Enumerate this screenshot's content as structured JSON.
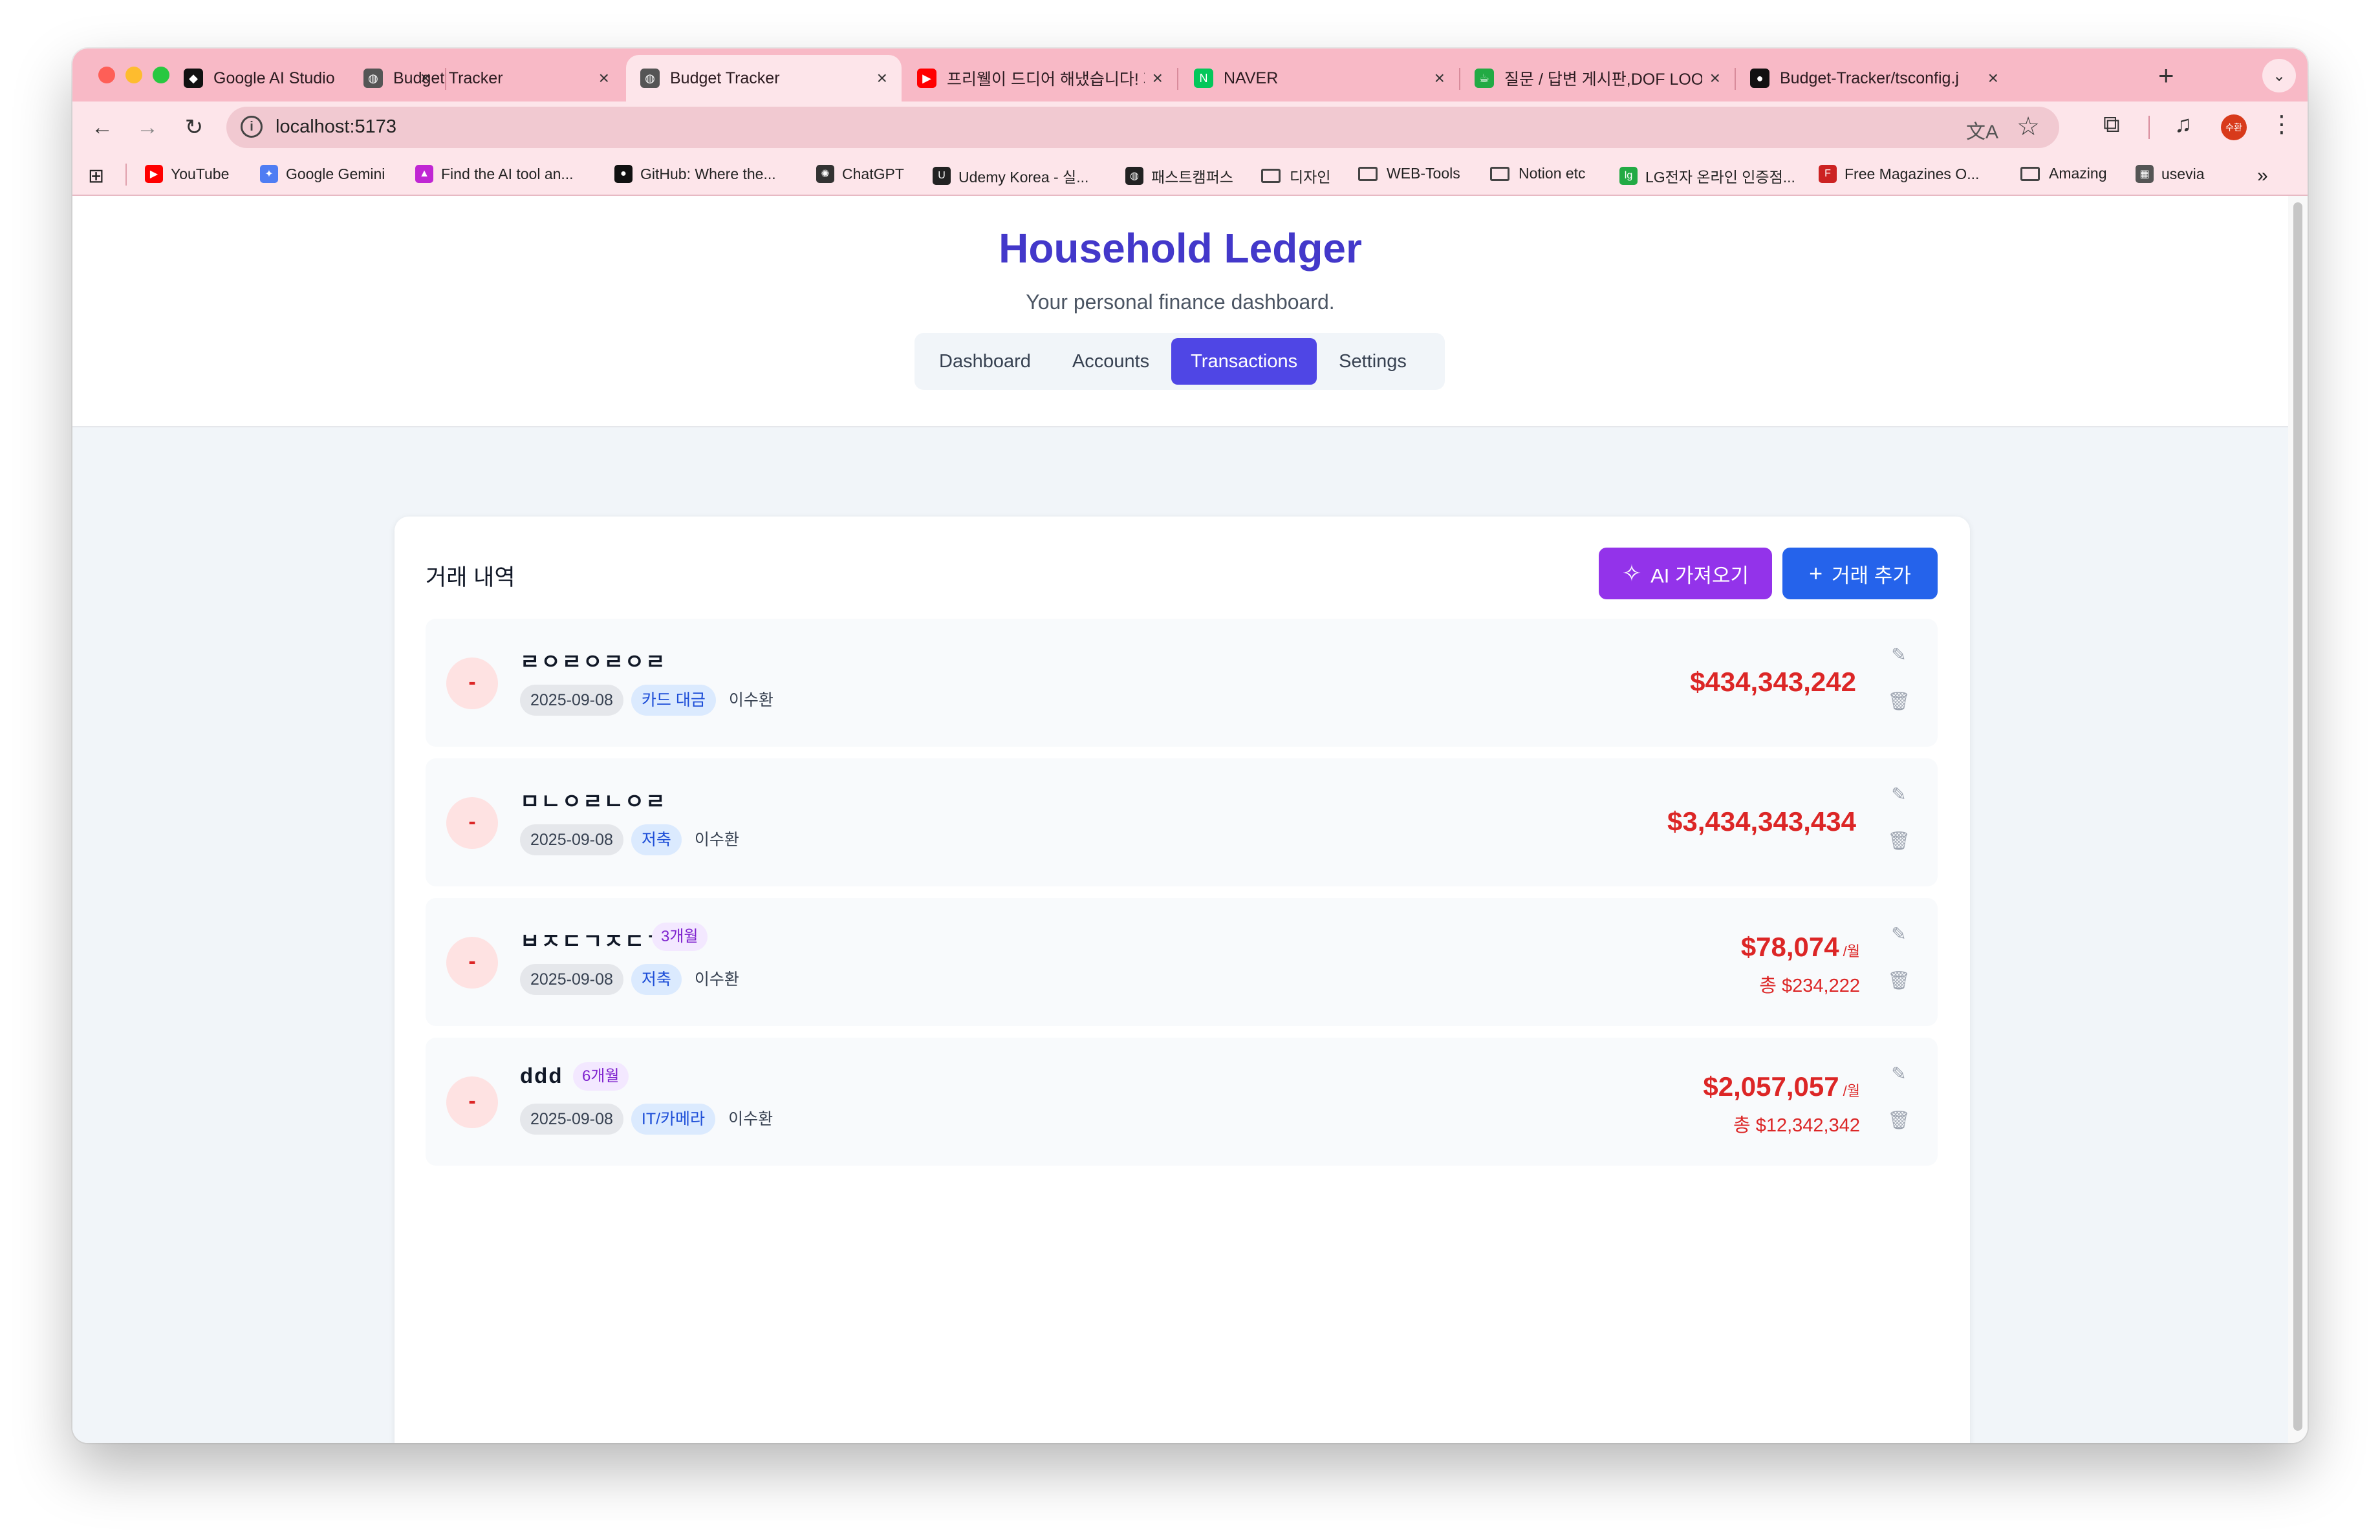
{
  "browser": {
    "tabs": [
      {
        "title": "Google AI Studio",
        "favicon": "ai-studio-icon",
        "color": "#111111",
        "active": false
      },
      {
        "title": "Budget Tracker",
        "favicon": "globe-icon",
        "color": "#555555",
        "active": false
      },
      {
        "title": "Budget Tracker",
        "favicon": "globe-icon",
        "color": "#555555",
        "active": true
      },
      {
        "title": "프리웰이 드디어 해냈습니다! 자",
        "favicon": "youtube-icon",
        "color": "#ff0000",
        "active": false
      },
      {
        "title": "NAVER",
        "favicon": "naver-icon",
        "color": "#03c75a",
        "active": false
      },
      {
        "title": "질문 / 답변 게시판,DOF LOOK",
        "favicon": "cup-icon",
        "color": "#22aa44",
        "active": false
      },
      {
        "title": "Budget-Tracker/tsconfig.j",
        "favicon": "github-icon",
        "color": "#111111",
        "active": false
      }
    ],
    "address": "localhost:5173",
    "bookmarks": [
      {
        "label": "YouTube",
        "icon": "youtube-icon",
        "color": "#ff0000",
        "folder": false
      },
      {
        "label": "Google Gemini",
        "icon": "gemini-icon",
        "color": "#4f7df3",
        "folder": false
      },
      {
        "label": "Find the AI tool an...",
        "icon": "ai-tool-icon",
        "color": "#c026d3",
        "folder": false
      },
      {
        "label": "GitHub: Where the...",
        "icon": "github-icon",
        "color": "#111111",
        "folder": false
      },
      {
        "label": "ChatGPT",
        "icon": "chatgpt-icon",
        "color": "#333333",
        "folder": false
      },
      {
        "label": "Udemy Korea - 실...",
        "icon": "udemy-icon",
        "color": "#222222",
        "folder": false
      },
      {
        "label": "패스트캠퍼스",
        "icon": "globe-icon",
        "color": "#222222",
        "folder": false
      },
      {
        "label": "디자인",
        "icon": "folder-icon",
        "color": "#444444",
        "folder": true
      },
      {
        "label": "WEB-Tools",
        "icon": "folder-icon",
        "color": "#444444",
        "folder": true
      },
      {
        "label": "Notion etc",
        "icon": "folder-icon",
        "color": "#444444",
        "folder": true
      },
      {
        "label": "LG전자 온라인 인증점...",
        "icon": "lg-icon",
        "color": "#22aa44",
        "folder": false
      },
      {
        "label": "Free Magazines O...",
        "icon": "magazine-icon",
        "color": "#cc2222",
        "folder": false
      },
      {
        "label": "Amazing",
        "icon": "folder-icon",
        "color": "#444444",
        "folder": true
      },
      {
        "label": "usevia",
        "icon": "usevia-icon",
        "color": "#555555",
        "folder": false
      }
    ],
    "profile_initials": "수환"
  },
  "app": {
    "title": "Household Ledger",
    "subtitle": "Your personal finance dashboard.",
    "nav": [
      {
        "label": "Dashboard",
        "active": false
      },
      {
        "label": "Accounts",
        "active": false
      },
      {
        "label": "Transactions",
        "active": true
      },
      {
        "label": "Settings",
        "active": false
      }
    ],
    "accent": "#4f46e5",
    "section_title": "거래 내역",
    "ai_button": "AI 가져오기",
    "add_button": "거래 추가",
    "transactions": [
      {
        "sign": "-",
        "description": "ㄹㅇㄹㅇㄹㅇㄹ",
        "months": "",
        "date": "2025-09-08",
        "category": "카드 대금",
        "user": "이수환",
        "amount": "$434,343,242",
        "unit": "",
        "total": ""
      },
      {
        "sign": "-",
        "description": "ㅁㄴㅇㄹㄴㅇㄹ",
        "months": "",
        "date": "2025-09-08",
        "category": "저축",
        "user": "이수환",
        "amount": "$3,434,343,434",
        "unit": "",
        "total": ""
      },
      {
        "sign": "-",
        "description": "ㅂㅈㄷㄱㅈㄷㄱ",
        "months": "3개월",
        "date": "2025-09-08",
        "category": "저축",
        "user": "이수환",
        "amount": "$78,074",
        "unit": "/월",
        "total": "총 $234,222"
      },
      {
        "sign": "-",
        "description": "ddd",
        "months": "6개월",
        "date": "2025-09-08",
        "category": "IT/카메라",
        "user": "이수환",
        "amount": "$2,057,057",
        "unit": "/월",
        "total": "총 $12,342,342"
      }
    ]
  }
}
